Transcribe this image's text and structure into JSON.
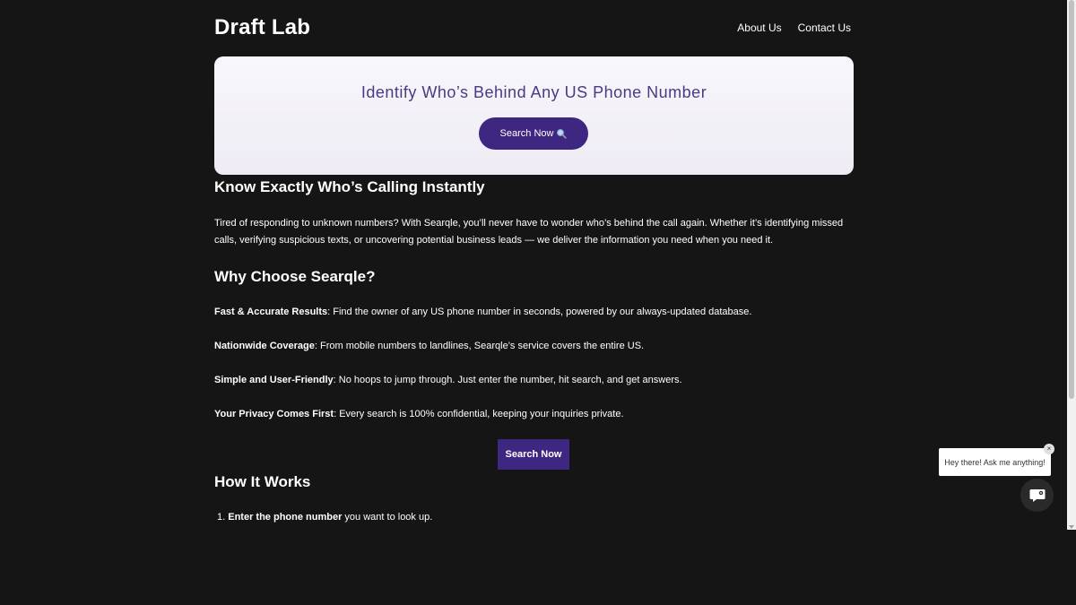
{
  "header": {
    "brand": "Draft Lab",
    "nav": [
      "About Us",
      "Contact Us"
    ]
  },
  "hero": {
    "title": "Identify Who’s Behind Any US Phone Number",
    "button_label": "Search Now",
    "button_icon": "magnifier-icon"
  },
  "section1": {
    "title": "Know Exactly Who’s Calling Instantly",
    "body": "Tired of responding to unknown numbers? With Searqle, you’ll never have to wonder who’s behind the call again. Whether it’s identifying missed calls, verifying suspicious texts, or uncovering potential business leads — we deliver the information you need when you need it."
  },
  "section2": {
    "title": "Why Choose Searqle?",
    "features": [
      {
        "title": "Fast & Accurate Results",
        "text": ": Find the owner of any US phone number in seconds, powered by our always-updated database."
      },
      {
        "title": "Nationwide Coverage",
        "text": ": From mobile numbers to landlines, Searqle’s service covers the entire US."
      },
      {
        "title": "Simple and User-Friendly",
        "text": ": No hoops to jump through. Just enter the number, hit search, and get answers."
      },
      {
        "title": "Your Privacy Comes First",
        "text": ": Every search is 100% confidential, keeping your inquiries private."
      }
    ],
    "cta_label": "Search Now"
  },
  "section3": {
    "title": "How It Works",
    "steps": [
      {
        "number": "1.",
        "bold": "Enter the phone number",
        "text": " you want to look up."
      }
    ]
  },
  "chat": {
    "message": "Hey there! Ask me anything!",
    "close_symbol": "×"
  },
  "colors": {
    "background": "#151515",
    "accent": "#3e2780",
    "hero_title": "#4a3a86"
  }
}
